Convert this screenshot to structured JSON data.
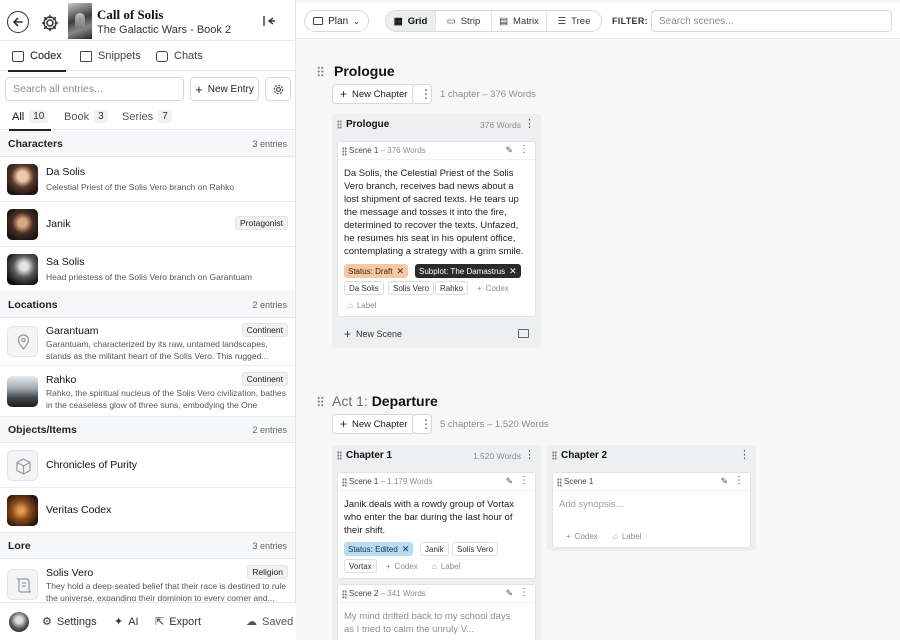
{
  "book": {
    "title": "Call of Solis",
    "subtitle": "The Galactic Wars - Book 2"
  },
  "tabs": [
    {
      "label": "Codex",
      "active": true
    },
    {
      "label": "Snippets"
    },
    {
      "label": "Chats"
    }
  ],
  "search": {
    "placeholder": "Search all entries...",
    "new_entry_label": "New Entry"
  },
  "filters": [
    {
      "label": "All",
      "count": "10",
      "active": true
    },
    {
      "label": "Book",
      "count": "3"
    },
    {
      "label": "Series",
      "count": "7"
    }
  ],
  "codex": {
    "sections": [
      {
        "title": "Characters",
        "count": "3 entries",
        "entries": [
          {
            "name": "Da Solis",
            "desc": "Celestial Priest of the Solis Vero branch on Rahko",
            "icon": "portrait-da-solis"
          },
          {
            "name": "Janik",
            "badge": "Protagonist",
            "icon": "portrait-janik"
          },
          {
            "name": "Sa Solis",
            "desc": "Head priestess of the Solis Vero branch on Garantuam",
            "icon": "portrait-sa-solis"
          }
        ]
      },
      {
        "title": "Locations",
        "count": "2 entries",
        "entries": [
          {
            "name": "Garantuam",
            "badge": "Continent",
            "desc": "Garantuam, characterized by its raw, untamed landscapes, stands as the militant heart of the Solis Vero. This rugged...",
            "icon": "map-pin-icon"
          },
          {
            "name": "Rahko",
            "badge": "Continent",
            "desc": "Rahko, the spiritual nucleus of the Solis Vero civilization, bathes in the ceaseless glow of three suns, embodying the One Force....",
            "icon": "city-image"
          }
        ]
      },
      {
        "title": "Objects/Items",
        "count": "2 entries",
        "entries": [
          {
            "name": "Chronicles of Purity",
            "icon": "cube-icon"
          },
          {
            "name": "Veritas Codex",
            "icon": "codex-image"
          }
        ]
      },
      {
        "title": "Lore",
        "count": "3 entries",
        "entries": [
          {
            "name": "Solis Vero",
            "badge": "Religion",
            "desc": "They hold a deep-seated belief that their race is destined to rule the universe, expanding their dominion to every corner and...",
            "icon": "scroll-icon"
          }
        ]
      }
    ]
  },
  "footer": {
    "settings": "Settings",
    "ai": "AI",
    "export": "Export",
    "saved": "Saved"
  },
  "toolbar": {
    "plan_label": "Plan",
    "views": [
      {
        "label": "Grid",
        "active": true
      },
      {
        "label": "Strip"
      },
      {
        "label": "Matrix"
      },
      {
        "label": "Tree"
      }
    ],
    "filter_label": "FILTER:",
    "search_placeholder": "Search scenes..."
  },
  "acts": [
    {
      "label": "",
      "title": "Prologue",
      "new_chapter": "New Chapter",
      "meta": "1 chapter  –  376 Words",
      "chapters": [
        {
          "name": "Prologue",
          "words": "376 Words",
          "new_scene": "New Scene",
          "scenes": [
            {
              "label": "Scene 1",
              "words": "376 Words",
              "text": [
                "Da Solis, the Celestial Priest of the Solis",
                "Vero branch, receives bad news about a",
                "lost shipment of sacred texts. He tears up",
                "the message and tosses it into the fire,",
                "determined to recover the texts. Unfazed,",
                "he resumes his seat in his opulent office,",
                "contemplating a strategy with a grim smile."
              ],
              "status": "Status: Draft",
              "subplot": "Subplot: The Damastrus",
              "codex_tags": [
                "Da Solis",
                "Solis Vero",
                "Rahko"
              ],
              "add_codex": "Codex",
              "add_label": "Label"
            }
          ]
        }
      ]
    },
    {
      "label": "Act 1:",
      "title": "Departure",
      "new_chapter": "New Chapter",
      "meta": "5 chapters  –  1.520 Words",
      "chapters": [
        {
          "name": "Chapter 1",
          "words": "1.520 Words",
          "scenes": [
            {
              "label": "Scene 1",
              "words": "1.179 Words",
              "text": [
                "Janik deals with a rowdy group of Vortax",
                "who enter the bar during the last hour of",
                "their shift."
              ],
              "status": "Status: Edited",
              "codex_tags": [
                "Janik",
                "Solis Vero",
                "Vortax"
              ],
              "add_codex": "Codex",
              "add_label": "Label"
            },
            {
              "label": "Scene 2",
              "words": "341 Words",
              "text": [
                "My mind drifted back to my school days",
                "as I tried to calm the unruly V..."
              ]
            }
          ]
        },
        {
          "name": "Chapter 2",
          "words": "",
          "scenes": [
            {
              "label": "Scene 1",
              "words": "",
              "placeholder": "Add synopsis...",
              "add_codex": "Codex",
              "add_label": "Label"
            }
          ]
        }
      ]
    }
  ]
}
